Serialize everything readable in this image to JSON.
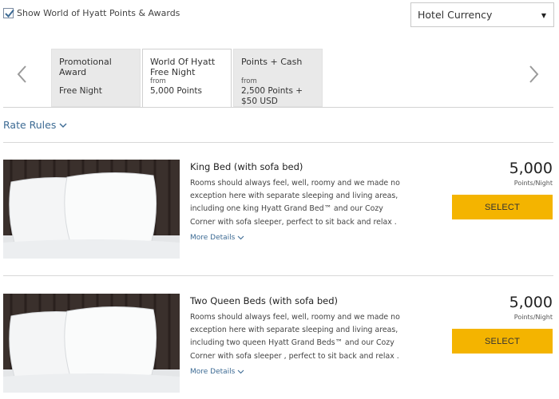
{
  "header": {
    "show_points_label": "Show World of Hyatt Points & Awards",
    "show_points_checked": true,
    "currency_selected": "Hotel Currency"
  },
  "rate_tabs": [
    {
      "line1": "Promotional",
      "line2": "Award",
      "from": "",
      "value": "Free Night",
      "value2": ""
    },
    {
      "line1": "World Of Hyatt",
      "line2": "Free Night",
      "from": "from",
      "value": "5,000 Points",
      "value2": ""
    },
    {
      "line1": "Points + Cash",
      "line2": "",
      "from": "from",
      "value": "2,500 Points +",
      "value2": "$50 USD"
    }
  ],
  "active_tab": 1,
  "rate_rules_label": "Rate Rules",
  "rooms": [
    {
      "title": "King Bed (with sofa bed)",
      "description": "Rooms should always feel, well, roomy and we made no exception here with separate sleeping and living areas, including one king Hyatt Grand Bed™ and our Cozy Corner with sofa sleeper, perfect to sit back and relax . With your stay, enjoy free Wi-Fi and our a.m. Kitchen",
      "more_label": "More Details",
      "points": "5,000",
      "unit": "Points/Night",
      "select_label": "SELECT"
    },
    {
      "title": "Two Queen Beds (with sofa bed)",
      "description": "Rooms should always feel, well, roomy and we made no exception here with separate sleeping and living areas, including two queen Hyatt Grand Beds™ and our Cozy Corner with sofa sleeper , perfect to sit back and relax . With your stay, enjoy free Wi-Fi and our a.m. Kitchen",
      "more_label": "More Details",
      "points": "5,000",
      "unit": "Points/Night",
      "select_label": "SELECT"
    }
  ],
  "colors": {
    "link": "#3d6b94",
    "select_button": "#f4b400",
    "active_tab_bg": "#ffffff",
    "inactive_tab_bg": "#e9e9e9"
  }
}
